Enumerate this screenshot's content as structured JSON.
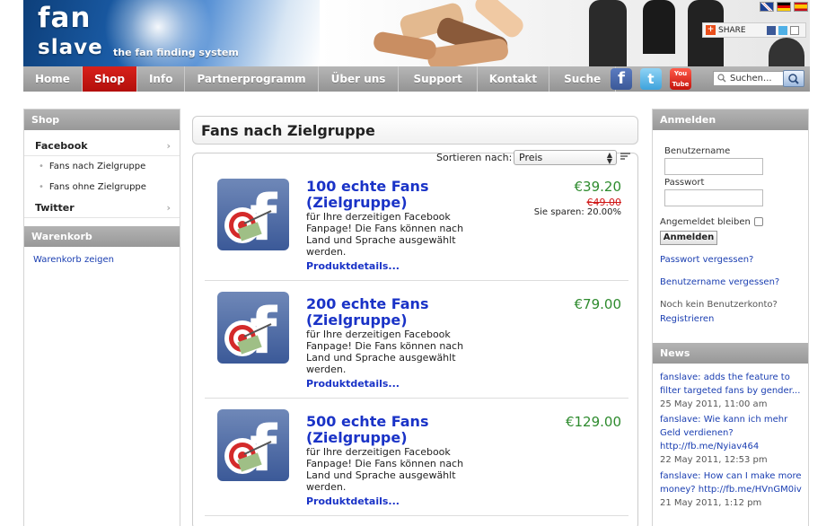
{
  "header": {
    "logo_line1": "fan",
    "logo_line2": "slave",
    "tagline": "the fan finding system",
    "share_label": "SHARE"
  },
  "nav": {
    "items": [
      {
        "label": "Home"
      },
      {
        "label": "Shop"
      },
      {
        "label": "Info"
      },
      {
        "label": "Partnerprogramm"
      },
      {
        "label": "Über uns"
      },
      {
        "label": "Support"
      },
      {
        "label": "Kontakt"
      },
      {
        "label": "Suche"
      }
    ],
    "search_placeholder": "Suchen..."
  },
  "left": {
    "shop_head": "Shop",
    "facebook": "Facebook",
    "sub1": "Fans nach Zielgruppe",
    "sub2": "Fans ohne Zielgruppe",
    "twitter": "Twitter",
    "cart_head": "Warenkorb",
    "cart_link": "Warenkorb zeigen"
  },
  "main": {
    "title": "Fans nach Zielgruppe",
    "sort_label": "Sortieren nach:",
    "sort_value": "Preis",
    "products": [
      {
        "title": "100 echte Fans (Zielgruppe)",
        "desc": "für Ihre derzeitigen Facebook Fanpage! Die Fans können nach Land und Sprache ausgewählt werden.",
        "details": "Produktdetails...",
        "price": "€39.20",
        "old_price": "€49.00",
        "saving": "Sie sparen:  20.00%"
      },
      {
        "title": "200 echte Fans (Zielgruppe)",
        "desc": "für Ihre derzeitigen Facebook Fanpage! Die Fans können nach Land und Sprache ausgewählt werden.",
        "details": "Produktdetails...",
        "price": "€79.00"
      },
      {
        "title": "500 echte Fans (Zielgruppe)",
        "desc": "für Ihre derzeitigen Facebook Fanpage! Die Fans können nach Land und Sprache ausgewählt werden.",
        "details": "Produktdetails...",
        "price": "€129.00"
      }
    ]
  },
  "right": {
    "login_head": "Anmelden",
    "username_label": "Benutzername",
    "password_label": "Passwort",
    "remember_label": "Angemeldet bleiben",
    "login_button": "Anmelden",
    "forgot_password": "Passwort vergessen?",
    "forgot_username": "Benutzername vergessen?",
    "no_account": "Noch kein Benutzerkonto?",
    "register": "Registrieren",
    "news_head": "News",
    "news": [
      {
        "text": "fanslave: adds the feature to filter targeted fans by gender...",
        "date": "25 May 2011, 11:00 am"
      },
      {
        "text": "fanslave: Wie kann ich mehr Geld verdienen? http://fb.me/Nyiav464",
        "date": "22 May 2011, 12:53 pm"
      },
      {
        "text": "fanslave: How can I make more money? http://fb.me/HVnGM0iv",
        "date": "21 May 2011, 1:12 pm"
      }
    ]
  },
  "colors": {
    "nav_active": "#c8170f",
    "link": "#1a33c7",
    "price": "#2e8b2e"
  }
}
